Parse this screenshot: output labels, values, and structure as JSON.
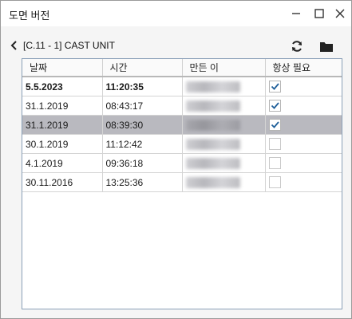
{
  "window": {
    "title": "도면 버전"
  },
  "toolbar": {
    "breadcrumb": "[C.11 - 1] CAST UNIT"
  },
  "table": {
    "columns": [
      "날짜",
      "시간",
      "만든 이",
      "항상 필요"
    ],
    "rows": [
      {
        "date": "5.5.2023",
        "time": "11:20:35",
        "always_needed": true,
        "bold": true,
        "selected": false
      },
      {
        "date": "31.1.2019",
        "time": "08:43:17",
        "always_needed": true,
        "bold": false,
        "selected": false
      },
      {
        "date": "31.1.2019",
        "time": "08:39:30",
        "always_needed": true,
        "bold": false,
        "selected": true
      },
      {
        "date": "30.1.2019",
        "time": "11:12:42",
        "always_needed": false,
        "bold": false,
        "selected": false
      },
      {
        "date": "4.1.2019",
        "time": "09:36:18",
        "always_needed": false,
        "bold": false,
        "selected": false
      },
      {
        "date": "30.11.2016",
        "time": "13:25:36",
        "always_needed": false,
        "bold": false,
        "selected": false
      }
    ]
  },
  "icons": {
    "back": "chevron-left-icon",
    "refresh": "refresh-icon",
    "folder": "folder-icon",
    "minimize": "minimize-icon",
    "maximize": "maximize-icon",
    "close": "close-icon"
  },
  "colors": {
    "selected_row": "#b9b9bf",
    "check_accent": "#1f5f9a",
    "table_border": "#8aa0b8"
  }
}
